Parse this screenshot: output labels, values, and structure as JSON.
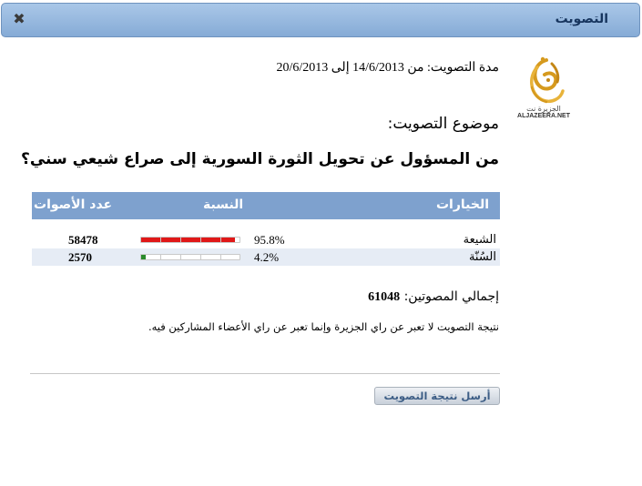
{
  "window": {
    "title": "التصويت",
    "close_glyph": "✖"
  },
  "logo": {
    "arabic_text": "الجزيرة نت",
    "wordmark": "ALJAZEERA.NET"
  },
  "poll": {
    "duration": "مدة التصويت: من 14/6/2013 إلى 20/6/2013",
    "subject_heading": "موضوع التصويت:",
    "question": "من المسؤول عن تحويل الثورة السورية إلى صراع شيعي سني؟",
    "columns": {
      "choices": "الخيارات",
      "percent": "النسبة",
      "votes": "عدد الأصوات"
    },
    "results": [
      {
        "choice": "الشيعة",
        "percent_text": "95.8%",
        "percent": 95.8,
        "votes": "58478",
        "bar_color": "#e01818"
      },
      {
        "choice": "السُنّة",
        "percent_text": "4.2%",
        "percent": 4.2,
        "votes": "2570",
        "bar_color": "#2a8a2a"
      }
    ],
    "total_label": "إجمالي المصوتين:",
    "total_value": "61048",
    "disclaimer": "نتيجة التصويت لا تعبر عن راي الجزيرة وإنما تعبر عن راي الأعضاء المشاركين فيه.",
    "send_button": "أرسل نتيجة التصويت"
  }
}
